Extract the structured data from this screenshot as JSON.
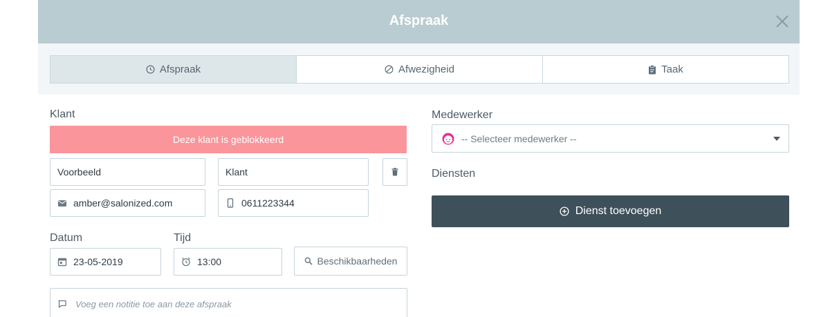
{
  "modal": {
    "title": "Afspraak",
    "colors": {
      "header": "#b9ccd2",
      "blocked": "#f9959b",
      "primary_button": "#3e5059"
    }
  },
  "tabs": [
    {
      "label": "Afspraak",
      "icon": "clock-icon",
      "active": true
    },
    {
      "label": "Afwezigheid",
      "icon": "ban-icon",
      "active": false
    },
    {
      "label": "Taak",
      "icon": "clipboard-icon",
      "active": false
    }
  ],
  "client": {
    "label": "Klant",
    "blocked_message": "Deze klant is geblokkeerd",
    "first_name": "Voorbeeld",
    "last_name": "Klant",
    "email": "amber@salonized.com",
    "phone": "0611223344"
  },
  "date": {
    "label": "Datum",
    "value": "23-05-2019"
  },
  "time": {
    "label": "Tijd",
    "value": "13:00"
  },
  "availability_button": "Beschikbaarheden",
  "note": {
    "placeholder": "Voeg een notitie toe aan deze afspraak"
  },
  "employee": {
    "label": "Medewerker",
    "selected": "-- Selecteer medewerker --"
  },
  "services": {
    "label": "Diensten",
    "add_button": "Dienst toevoegen"
  }
}
